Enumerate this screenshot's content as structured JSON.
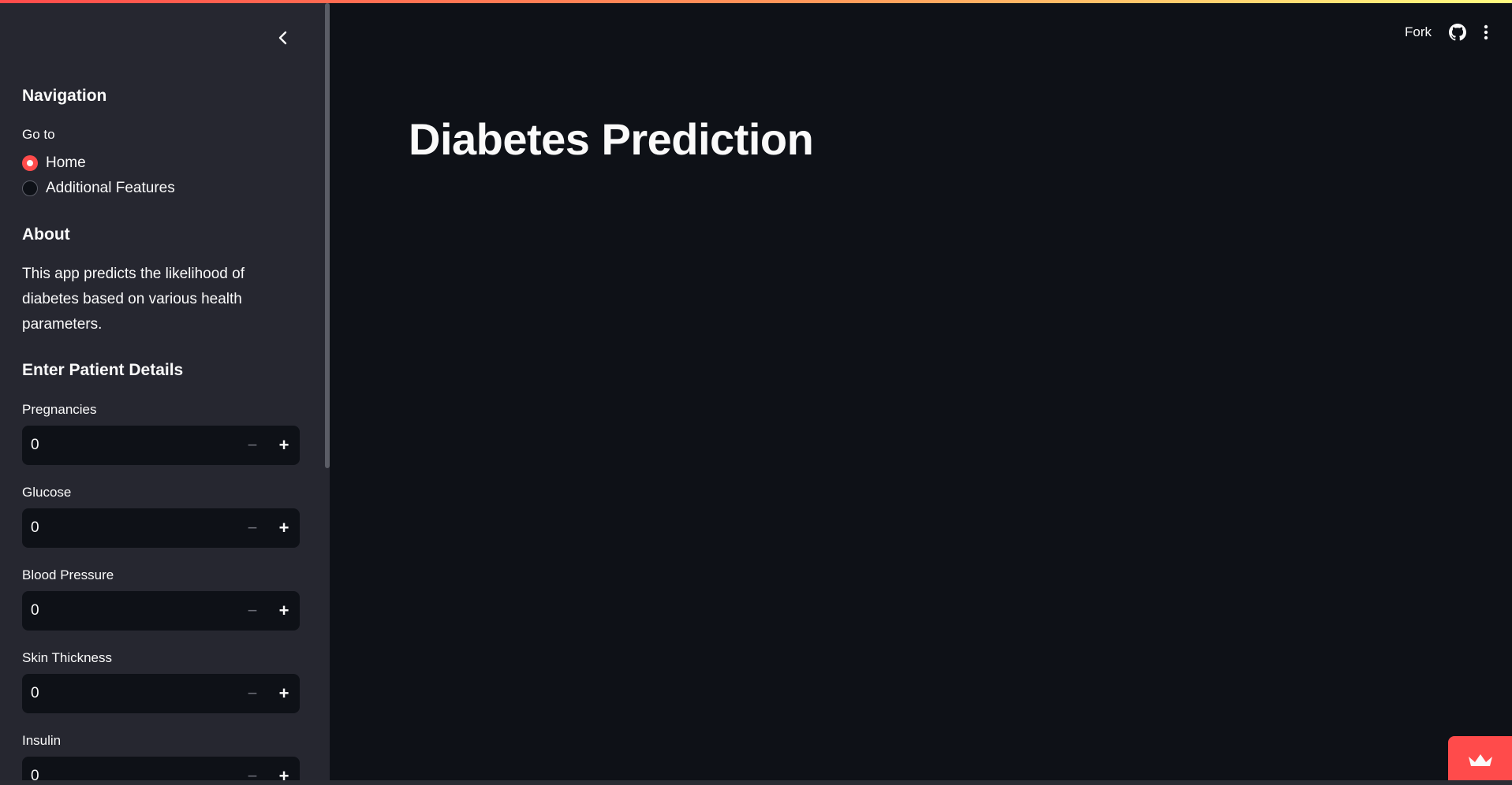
{
  "header": {
    "fork_label": "Fork",
    "github_icon": "github-icon",
    "menu_icon": "more-vertical-icon"
  },
  "sidebar": {
    "collapse_icon": "chevron-left-icon",
    "navigation_title": "Navigation",
    "goto_label": "Go to",
    "nav_options": [
      {
        "label": "Home",
        "selected": true
      },
      {
        "label": "Additional Features",
        "selected": false
      }
    ],
    "about_title": "About",
    "about_text": "This app predicts the likelihood of diabetes based on various health parameters.",
    "details_title": "Enter Patient Details",
    "fields": [
      {
        "label": "Pregnancies",
        "value": "0"
      },
      {
        "label": "Glucose",
        "value": "0"
      },
      {
        "label": "Blood Pressure",
        "value": "0"
      },
      {
        "label": "Skin Thickness",
        "value": "0"
      },
      {
        "label": "Insulin",
        "value": "0"
      }
    ]
  },
  "main": {
    "title": "Diabetes Prediction"
  },
  "colors": {
    "accent": "#ff4b4b",
    "sidebar_bg": "#262730",
    "main_bg": "#0e1117"
  }
}
